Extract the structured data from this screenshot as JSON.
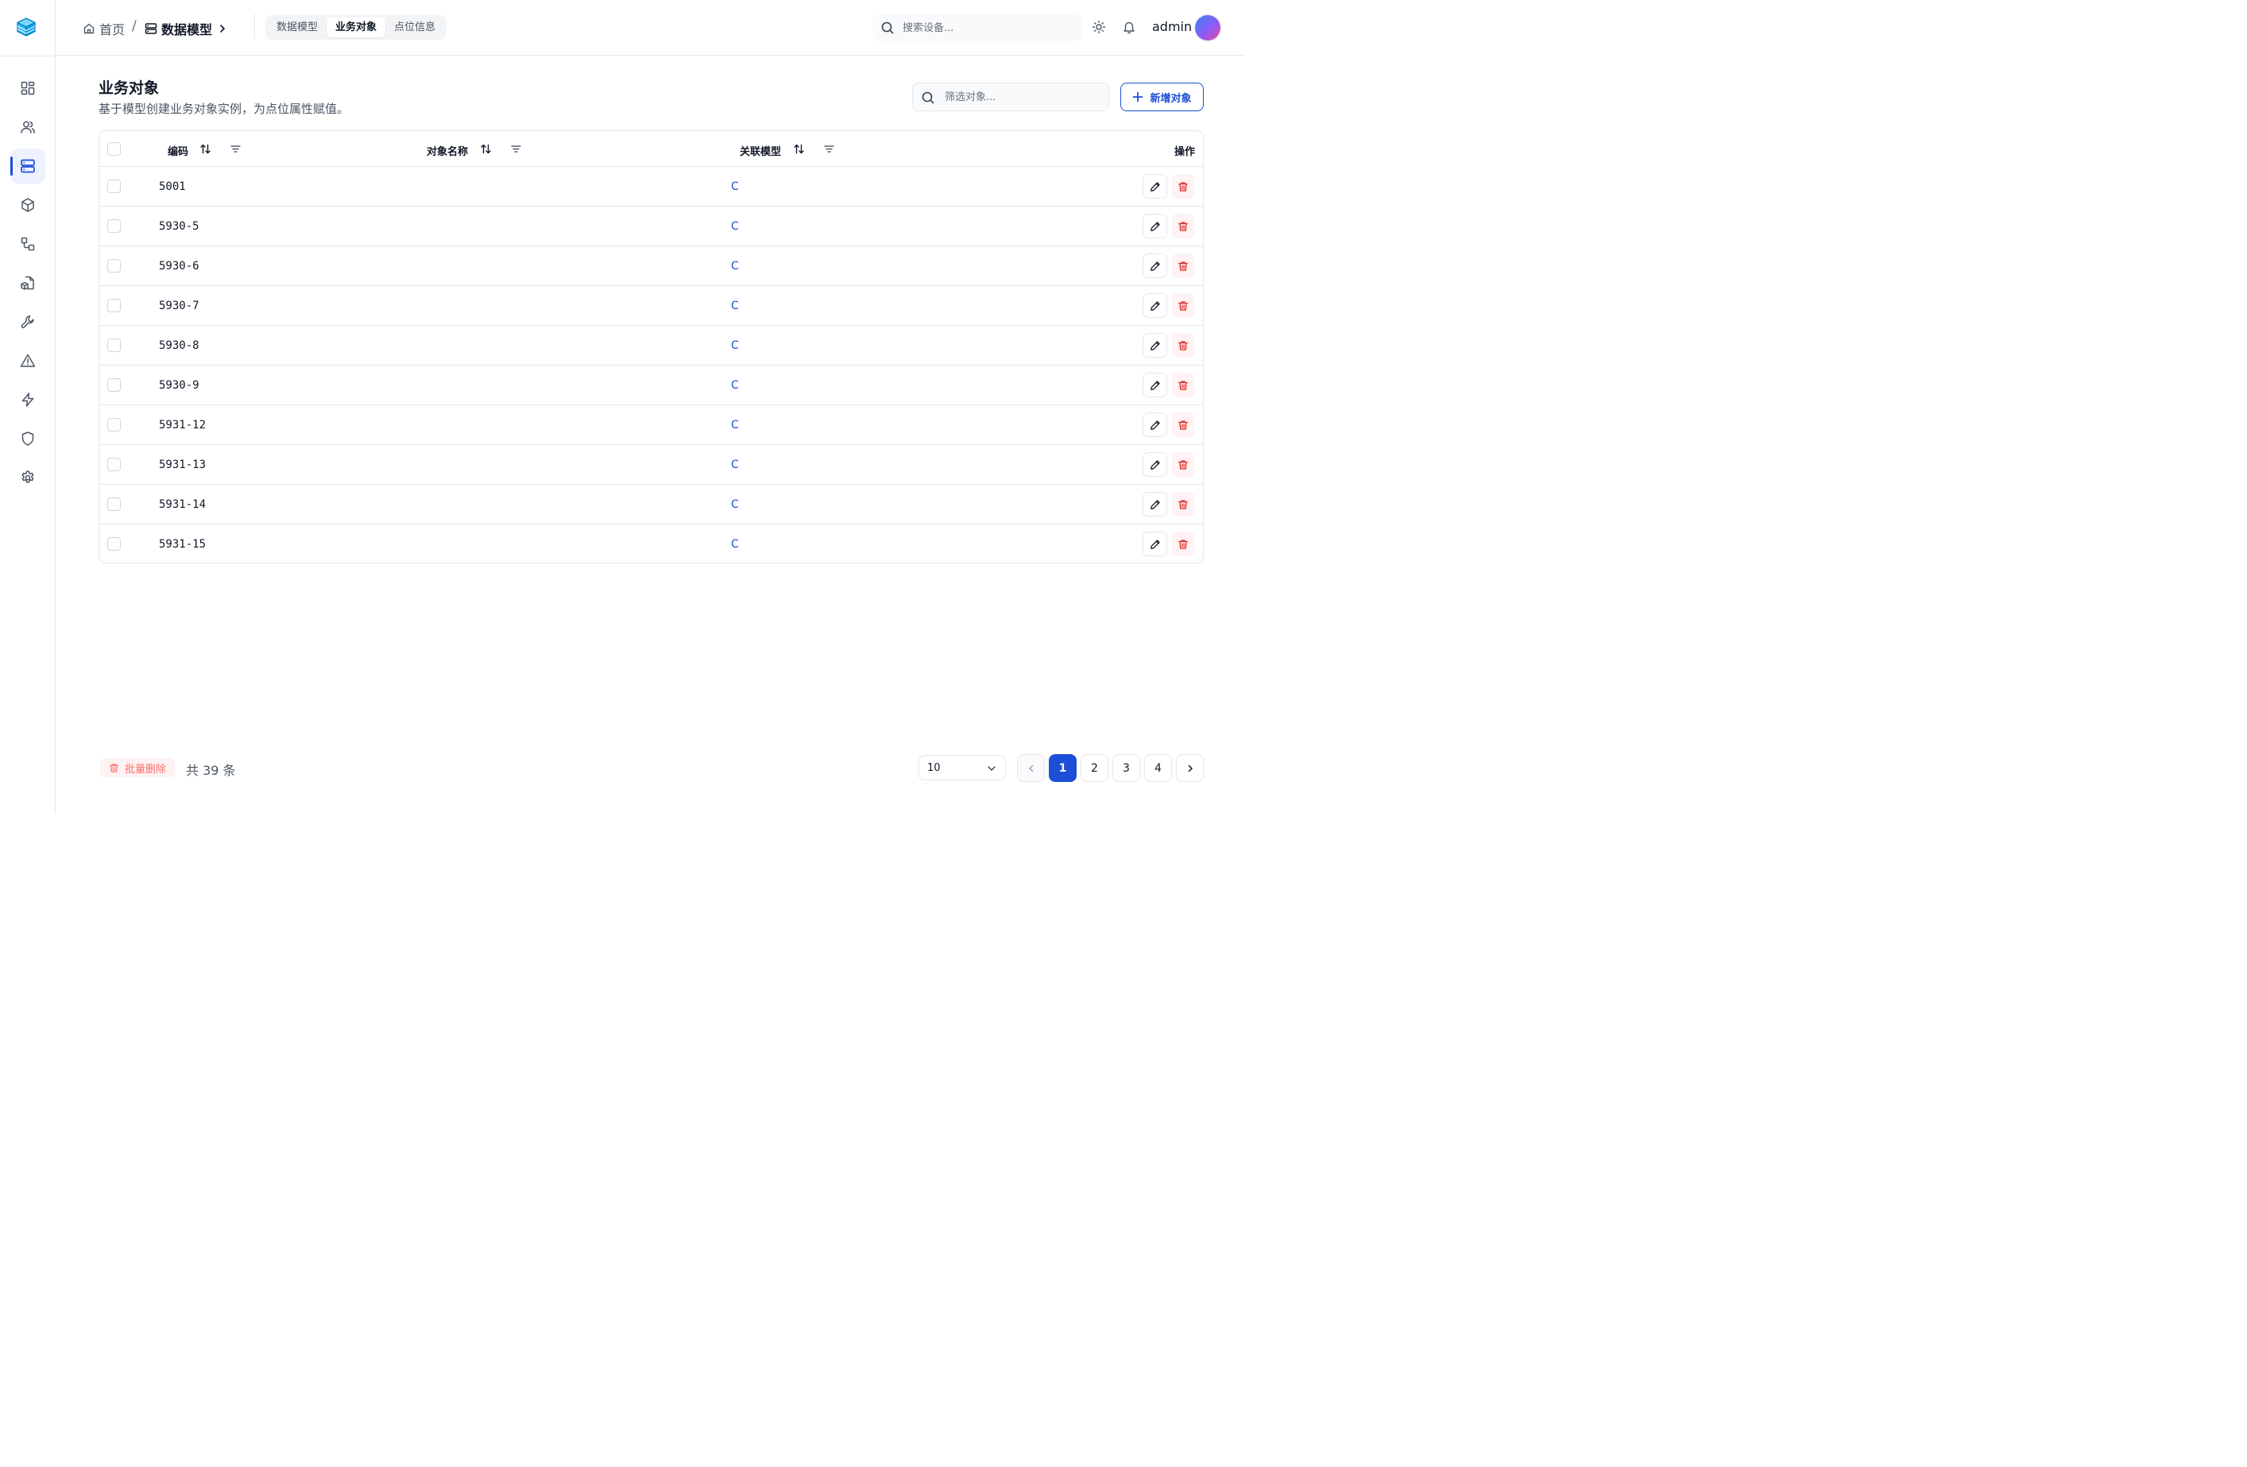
{
  "app": {
    "logo_icon": "cube-stack-logo-icon",
    "accent": "#1d4ed8"
  },
  "sidebar": {
    "items": [
      {
        "name": "dashboard",
        "icon": "grid-icon",
        "active": false
      },
      {
        "name": "users",
        "icon": "users-icon",
        "active": false
      },
      {
        "name": "data-model",
        "icon": "server-icon",
        "active": true
      },
      {
        "name": "objects",
        "icon": "cube-icon",
        "active": false
      },
      {
        "name": "workflow",
        "icon": "workflow-icon",
        "active": false
      },
      {
        "name": "files",
        "icon": "file-cube-icon",
        "active": false
      },
      {
        "name": "tools",
        "icon": "wrench-icon",
        "active": false
      },
      {
        "name": "alerts",
        "icon": "warning-icon",
        "active": false
      },
      {
        "name": "energy",
        "icon": "lightning-icon",
        "active": false
      },
      {
        "name": "security",
        "icon": "shield-icon",
        "active": false
      },
      {
        "name": "settings",
        "icon": "gear-icon",
        "active": false
      }
    ]
  },
  "header": {
    "breadcrumb": {
      "home": "首页",
      "separator": "/",
      "current": "数据模型"
    },
    "tabs": [
      {
        "label": "数据模型",
        "active": false
      },
      {
        "label": "业务对象",
        "active": true
      },
      {
        "label": "点位信息",
        "active": false
      }
    ],
    "search_placeholder": "搜索设备...",
    "username": "admin"
  },
  "main": {
    "title": "业务对象",
    "description": "基于模型创建业务对象实例，为点位属性赋值。",
    "filter_placeholder": "筛选对象...",
    "add_button": "新增对象",
    "table": {
      "columns": {
        "code": "编码",
        "name": "对象名称",
        "model": "关联模型",
        "actions": "操作"
      },
      "rows": [
        {
          "code": "5001",
          "name": "",
          "model": "C"
        },
        {
          "code": "5930-5",
          "name": "",
          "model": "C"
        },
        {
          "code": "5930-6",
          "name": "",
          "model": "C"
        },
        {
          "code": "5930-7",
          "name": "",
          "model": "C"
        },
        {
          "code": "5930-8",
          "name": "",
          "model": "C"
        },
        {
          "code": "5930-9",
          "name": "",
          "model": "C"
        },
        {
          "code": "5931-12",
          "name": "",
          "model": "C"
        },
        {
          "code": "5931-13",
          "name": "",
          "model": "C"
        },
        {
          "code": "5931-14",
          "name": "",
          "model": "C"
        },
        {
          "code": "5931-15",
          "name": "",
          "model": "C"
        }
      ]
    }
  },
  "footer": {
    "bulk_delete": "批量删除",
    "total": "共 39 条",
    "page_size": "10",
    "pages": [
      "1",
      "2",
      "3",
      "4"
    ],
    "current_page": "1"
  }
}
